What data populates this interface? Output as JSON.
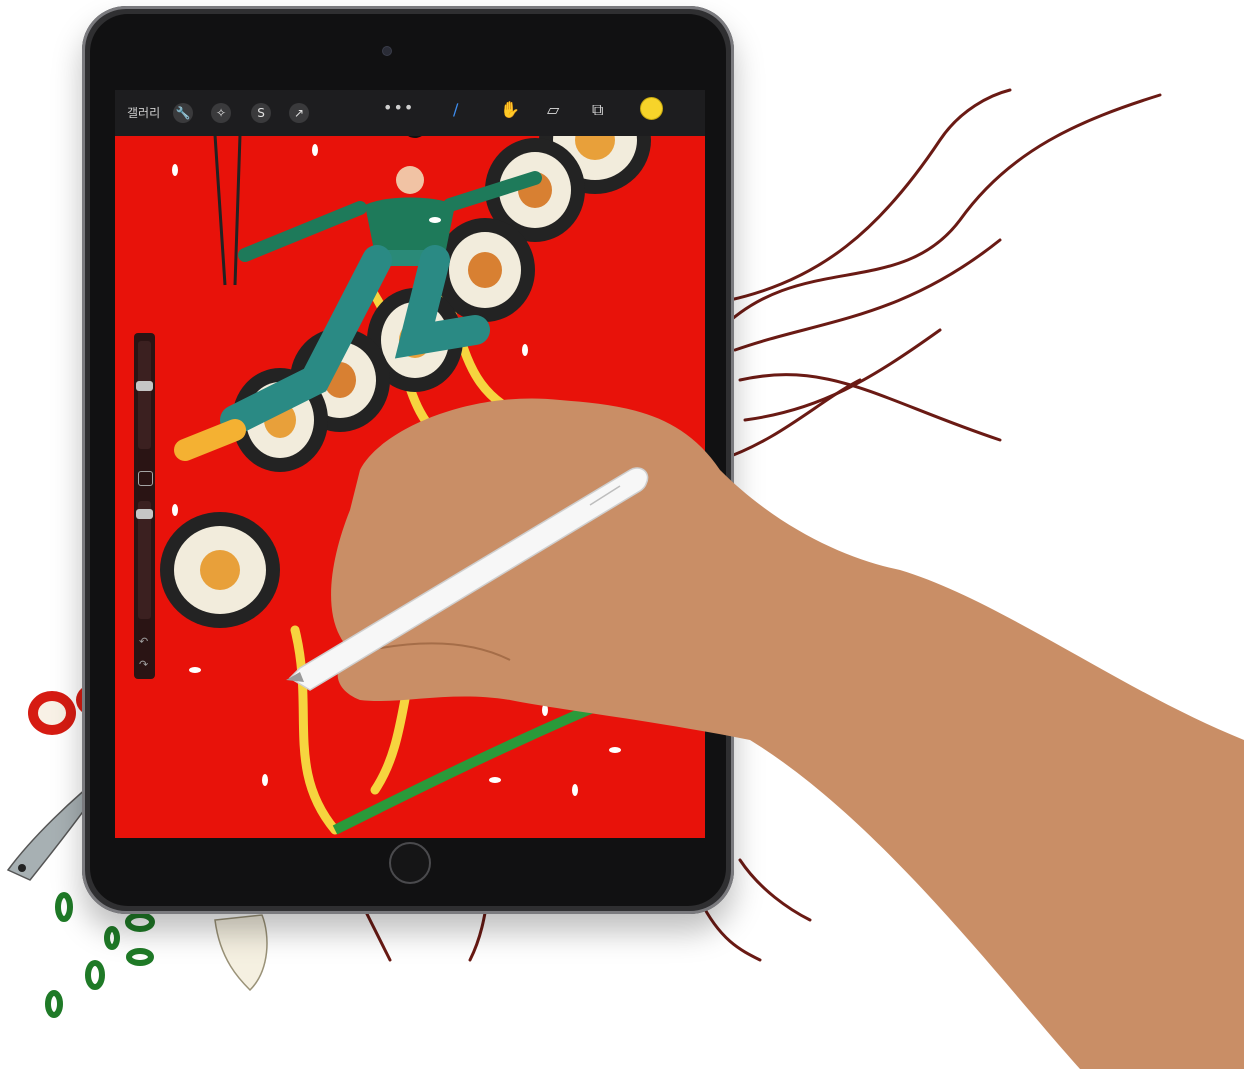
{
  "screen": {
    "toolbar": {
      "gallery_label": "갤러리"
    },
    "canvas_color": "#e8120a",
    "selected_color": "#f7d42a"
  },
  "icons": {
    "wrench": "wrench-icon",
    "magic": "adjustments-icon",
    "selection": "selection-icon",
    "transform": "transform-arrow-icon",
    "more": "more-dots-icon",
    "brush": "brush-icon",
    "smudge": "smudge-icon",
    "eraser": "eraser-icon",
    "layers": "layers-icon",
    "undo": "undo-icon",
    "redo": "redo-icon"
  }
}
